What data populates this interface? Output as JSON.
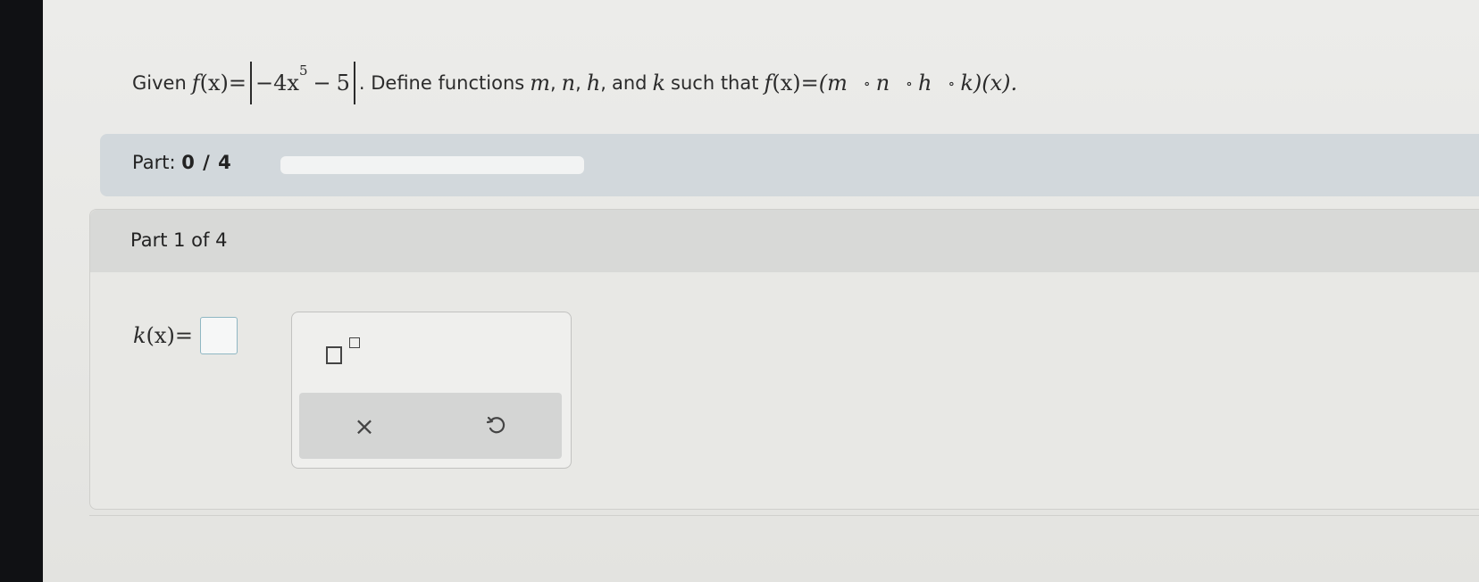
{
  "question": {
    "given_label": "Given",
    "f_lhs": "f",
    "arg_x": "(x)",
    "equals": "=",
    "coef_term": "−4x",
    "exponent": "5",
    "minus": "−",
    "constant": "5",
    "define_text": ". Define functions",
    "m": "m",
    "n": "n",
    "h": "h",
    "k": "k",
    "comma": ",",
    "and": "and",
    "such_that": "such that",
    "composition_open": "(m",
    "ring": "∘",
    "composition_close": "k)(x)."
  },
  "progress": {
    "label": "Part:",
    "value": "0 / 4",
    "fraction": 0.0
  },
  "part": {
    "title": "Part 1 of 4",
    "answer_label": "k",
    "answer_arg": "(x)",
    "answer_equals": "="
  },
  "keypad": {
    "clear_symbol": "×",
    "exponent_button_icon": "superscript-template-icon",
    "undo_icon": "undo-icon"
  },
  "colors": {
    "progress_band": "#d2d8dc",
    "answer_box_border": "#8fb7c3",
    "keypad_tray": "#d4d5d4"
  }
}
